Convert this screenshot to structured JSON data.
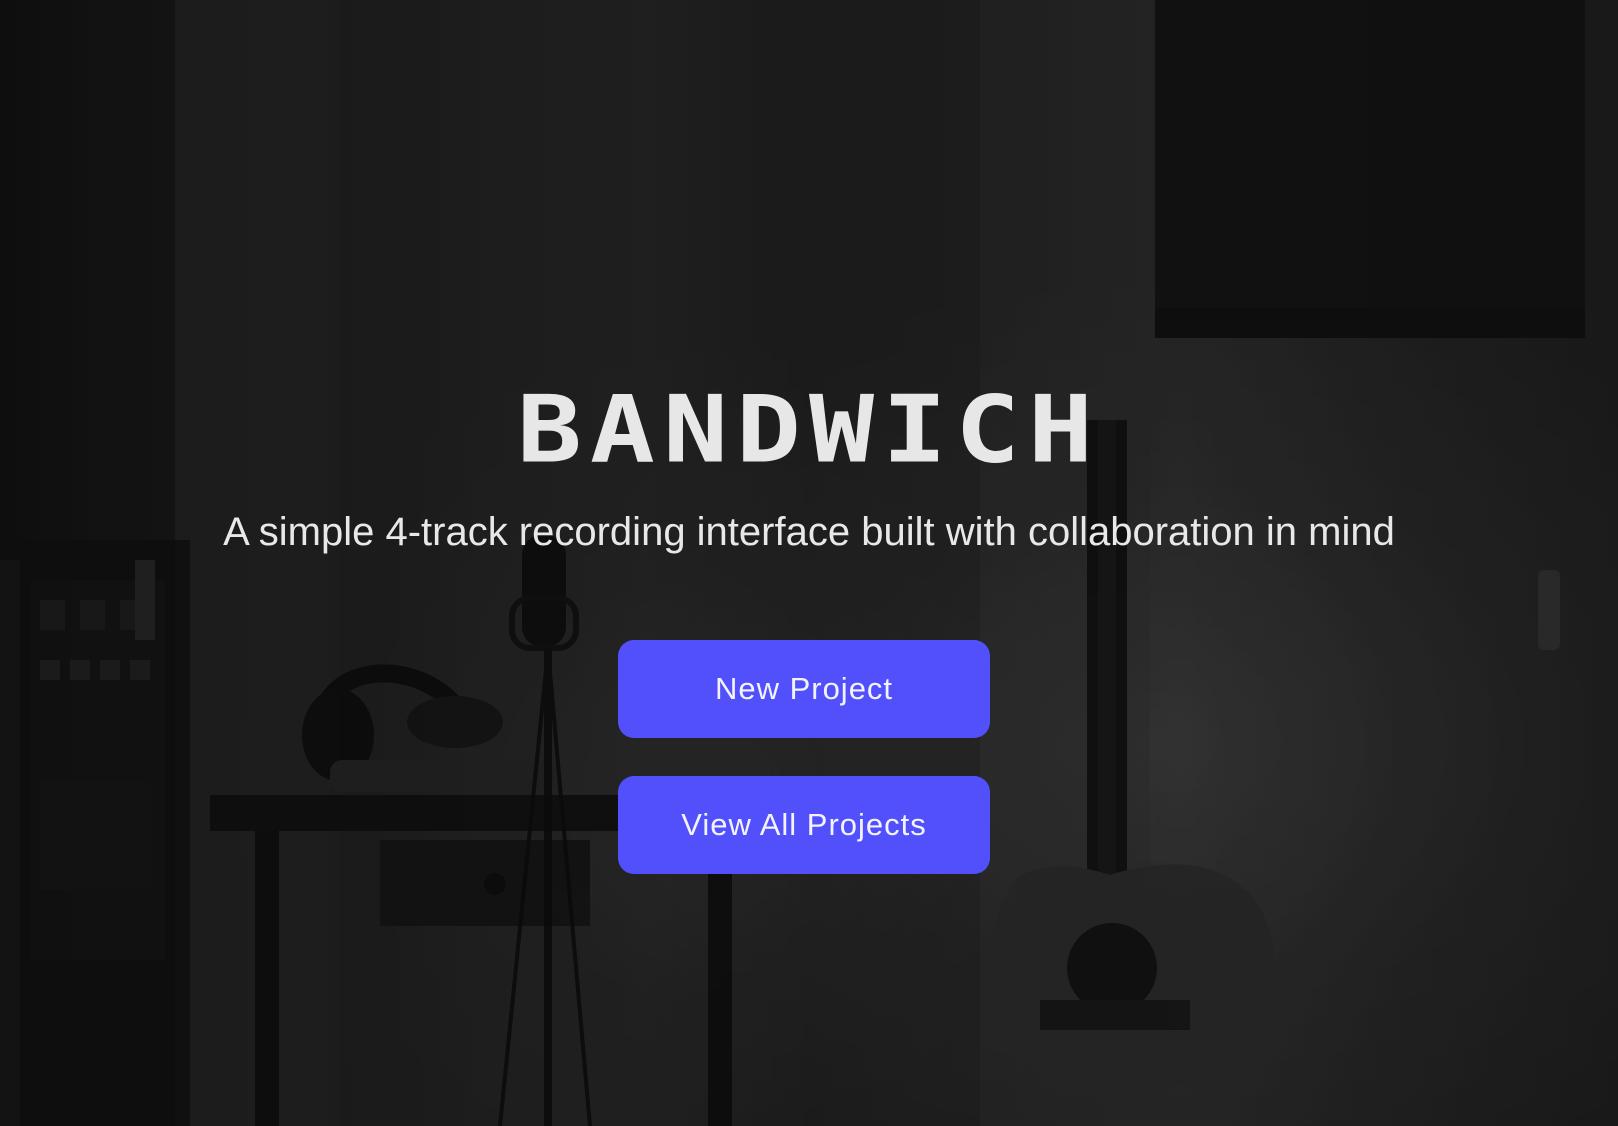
{
  "hero": {
    "title": "BANDWICH",
    "subtitle": "A simple 4-track recording interface built with collaboration in mind"
  },
  "actions": {
    "new_project_label": "New Project",
    "view_all_projects_label": "View All Projects"
  },
  "colors": {
    "accent": "#5150fb",
    "title_text": "#e7e7e7",
    "subtitle_text": "#e8e8e8",
    "button_text": "#f3f3ff",
    "background_dark": "#1c1c1c"
  },
  "background": {
    "scene": "dark studio with microphone, headphones, guitar, and keyboard",
    "icons": [
      "microphone-icon",
      "headphones-icon",
      "guitar-icon",
      "keyboard-icon"
    ]
  }
}
